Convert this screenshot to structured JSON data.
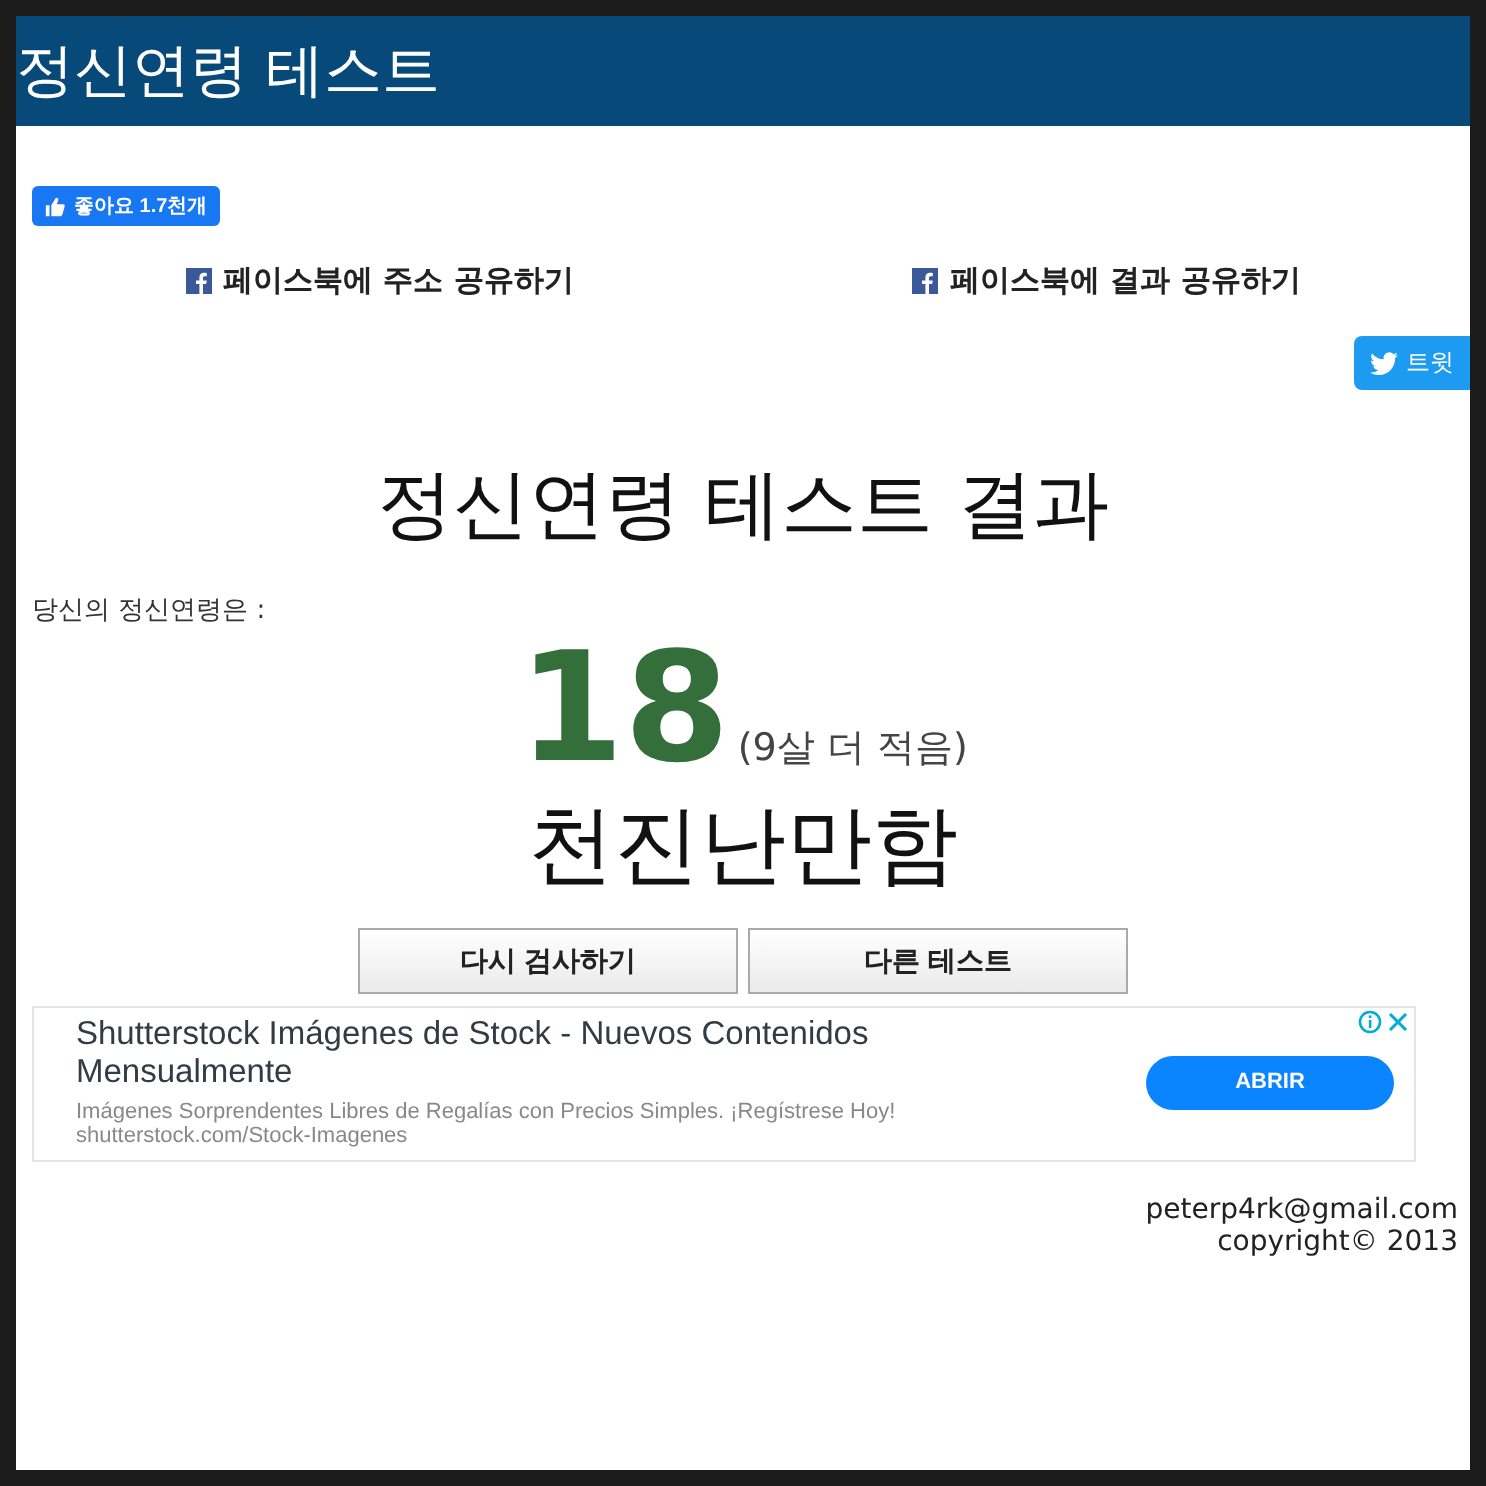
{
  "header": {
    "title": "정신연령 테스트"
  },
  "like_button": {
    "label": "좋아요 1.7천개"
  },
  "share_links": [
    {
      "label": "페이스북에 주소 공유하기"
    },
    {
      "label": "페이스북에 결과 공유하기"
    }
  ],
  "tweet_button": {
    "label": "트윗"
  },
  "result": {
    "title": "정신연령 테스트 결과",
    "prompt": "당신의 정신연령은 :",
    "age": "18",
    "difference": "(9살 더 적음)",
    "verdict": "천진난만함"
  },
  "buttons": [
    {
      "label": "다시 검사하기"
    },
    {
      "label": "다른 테스트"
    }
  ],
  "ad": {
    "headline": "Shutterstock Imágenes de Stock - Nuevos Contenidos Mensualmente",
    "description": "Imágenes Sorprendentes Libres de Regalías con Precios Simples. ¡Regístrese Hoy!",
    "url": "shutterstock.com/Stock-Imagenes",
    "cta": "ABRIR"
  },
  "footer": {
    "email": "peterp4rk@gmail.com",
    "copyright": "copyright© 2013"
  }
}
